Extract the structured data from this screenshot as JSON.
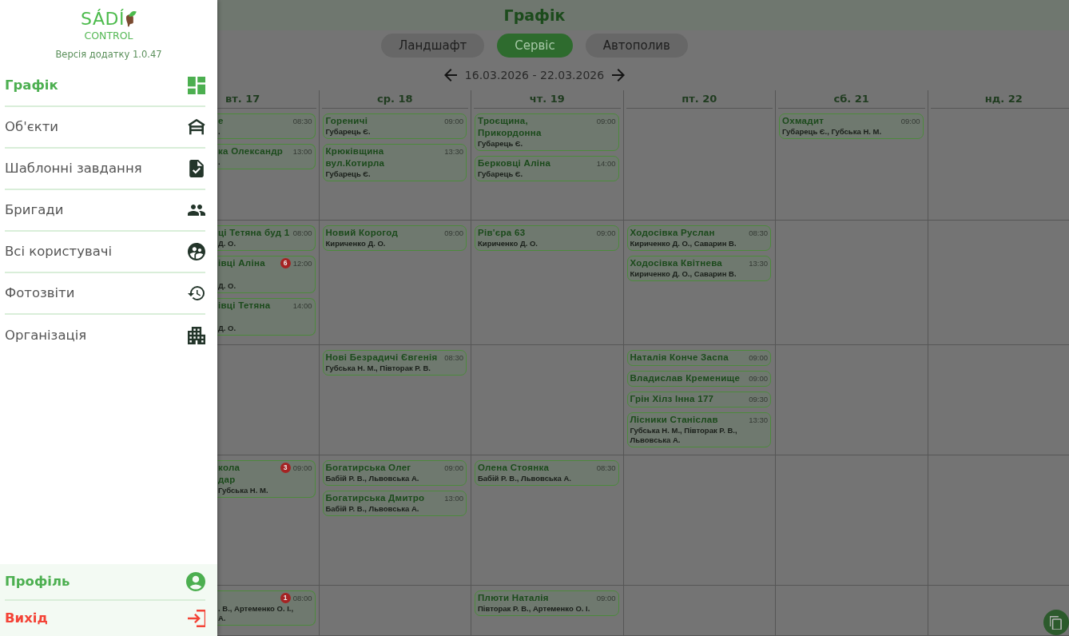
{
  "drawer": {
    "logo": {
      "wordmark": "SÁDÍ",
      "subtitle": "CONTROL"
    },
    "version": "Версія додатку 1.0.47",
    "items": [
      {
        "label": "Графік",
        "selected": true
      },
      {
        "label": "Об'єкти",
        "selected": false
      },
      {
        "label": "Шаблонні завдання",
        "selected": false
      },
      {
        "label": "Бригади",
        "selected": false
      },
      {
        "label": "Всі користувачі",
        "selected": false
      },
      {
        "label": "Фотозвіти",
        "selected": false
      },
      {
        "label": "Організація",
        "selected": false
      }
    ],
    "footer_items": [
      {
        "label": "Профіль",
        "kind": "profile"
      },
      {
        "label": "Вихід",
        "kind": "exit"
      }
    ]
  },
  "header": {
    "title": "Графік"
  },
  "tabs": [
    {
      "label": "Ландшафт",
      "selected": false
    },
    {
      "label": "Сервіс",
      "selected": true
    },
    {
      "label": "Автополив",
      "selected": false
    }
  ],
  "week": {
    "range": "16.03.2026 - 22.03.2026"
  },
  "days": [
    {
      "label": "вт. 17"
    },
    {
      "label": "ср. 18"
    },
    {
      "label": "чт. 19"
    },
    {
      "label": "пт. 20"
    },
    {
      "label": "сб. 21"
    },
    {
      "label": "нд. 22"
    }
  ],
  "rows": [
    {
      "cells": [
        {
          "cards": [
            {
              "title_lines": [
                "е"
              ],
              "time": "08:30",
              "names_lines": [
                "."
              ]
            },
            {
              "title_lines": [
                "ка Олександр"
              ],
              "time": "13:00",
              "names_lines": [
                "."
              ]
            }
          ]
        },
        {
          "cards": [
            {
              "title_lines": [
                "Гореничі"
              ],
              "time": "09:00",
              "names_lines": [
                "Губарець Є."
              ]
            },
            {
              "title_lines": [
                "Крюківщина",
                "вул.Котирла"
              ],
              "time": "13:30",
              "names_lines": [
                "Губарець Є."
              ]
            }
          ]
        },
        {
          "cards": [
            {
              "title_lines": [
                "Троєщина,",
                "Прикордонна"
              ],
              "time": "09:00",
              "names_lines": [
                "Губарець Є."
              ]
            },
            {
              "title_lines": [
                "Берковці Аліна"
              ],
              "time": "14:00",
              "names_lines": [
                "Губарець Є."
              ]
            }
          ]
        },
        {},
        {
          "cards": [
            {
              "title_lines": [
                "Охмадит"
              ],
              "time": "09:00",
              "names_lines": [
                "Губарець Є., Губська Н. М."
              ]
            }
          ]
        },
        {}
      ]
    },
    {
      "cells": [
        {
          "cards": [
            {
              "title_lines": [
                "ці Тетяна буд 1"
              ],
              "time": "08:00",
              "names_lines": [
                "Д. О."
              ]
            },
            {
              "title_lines": [
                "івці Аліна"
              ],
              "badge": "6",
              "time": "12:00",
              "hidden_title_line": true,
              "names_lines": [
                "Д. О."
              ]
            },
            {
              "title_lines": [
                "івці Тетяна"
              ],
              "time": "14:00",
              "hidden_title_line": true,
              "names_lines": [
                "Д. О."
              ]
            }
          ]
        },
        {
          "cards": [
            {
              "title_lines": [
                "Новий Корогод"
              ],
              "time": "09:00",
              "names_lines": [
                "Кириченко Д. О."
              ]
            }
          ]
        },
        {
          "cards": [
            {
              "title_lines": [
                "Рів'єра 63"
              ],
              "time": "09:00",
              "names_lines": [
                "Кириченко Д. О."
              ]
            }
          ]
        },
        {
          "cards": [
            {
              "title_lines": [
                "Ходосівка Руслан"
              ],
              "time": "08:30",
              "names_lines": [
                "Кириченко Д. О., Саварин В."
              ]
            },
            {
              "title_lines": [
                "Ходосівка Квітнева"
              ],
              "time": "13:30",
              "names_lines": [
                "Кириченко Д. О., Саварин В."
              ]
            }
          ]
        },
        {},
        {}
      ]
    },
    {
      "cells": [
        {},
        {
          "cards": [
            {
              "title_lines": [
                "Нові Безрадичі Євгенія"
              ],
              "time": "08:30",
              "names_lines": [
                "Губська Н. М., Півторак Р. В."
              ]
            }
          ]
        },
        {},
        {
          "cards": [
            {
              "title_lines": [
                "Наталія Конче Заспа"
              ],
              "time": "09:00"
            },
            {
              "title_lines": [
                "Владислав Кременище"
              ],
              "time": "09:00"
            },
            {
              "title_lines": [
                "Грін Хілз Інна 177"
              ],
              "time": "09:30"
            },
            {
              "title_lines": [
                "Лісники Станіслав"
              ],
              "time": "13:30",
              "names_lines": [
                "Губська Н. М., Півторак Р. В.,",
                "Львовська А."
              ]
            }
          ]
        },
        {},
        {}
      ]
    },
    {
      "cells": [
        {
          "cards": [
            {
              "title_lines": [
                "кола",
                "дар"
              ],
              "badge": "3",
              "time": "09:00",
              "names_lines": [
                "Губська Н. М."
              ]
            }
          ]
        },
        {
          "cards": [
            {
              "title_lines": [
                "Богатирська Олег"
              ],
              "time": "09:00",
              "names_lines": [
                "Бабій Р. В., Львовська А."
              ]
            },
            {
              "title_lines": [
                "Богатирська Дмитро"
              ],
              "time": "13:00",
              "names_lines": [
                "Бабій Р. В., Львовська А."
              ]
            }
          ]
        },
        {
          "cards": [
            {
              "title_lines": [
                "Олена Стоянка"
              ],
              "time": "08:30",
              "names_lines": [
                "Бабій Р. В., Львовська А."
              ]
            }
          ]
        },
        {},
        {},
        {}
      ]
    },
    {
      "cells": [
        {
          "cards": [
            {
              "badge": "1",
              "time": "08:00",
              "hidden_title_line": true,
              "names_lines": [
                ". В., Артеменко О. І.,",
                "А."
              ]
            }
          ]
        },
        {},
        {
          "cards": [
            {
              "title_lines": [
                "Плюти Наталія"
              ],
              "time": "09:00",
              "names_lines": [
                "Півторак Р. В., Артеменко О. І."
              ]
            }
          ]
        },
        {},
        {},
        {}
      ]
    }
  ]
}
